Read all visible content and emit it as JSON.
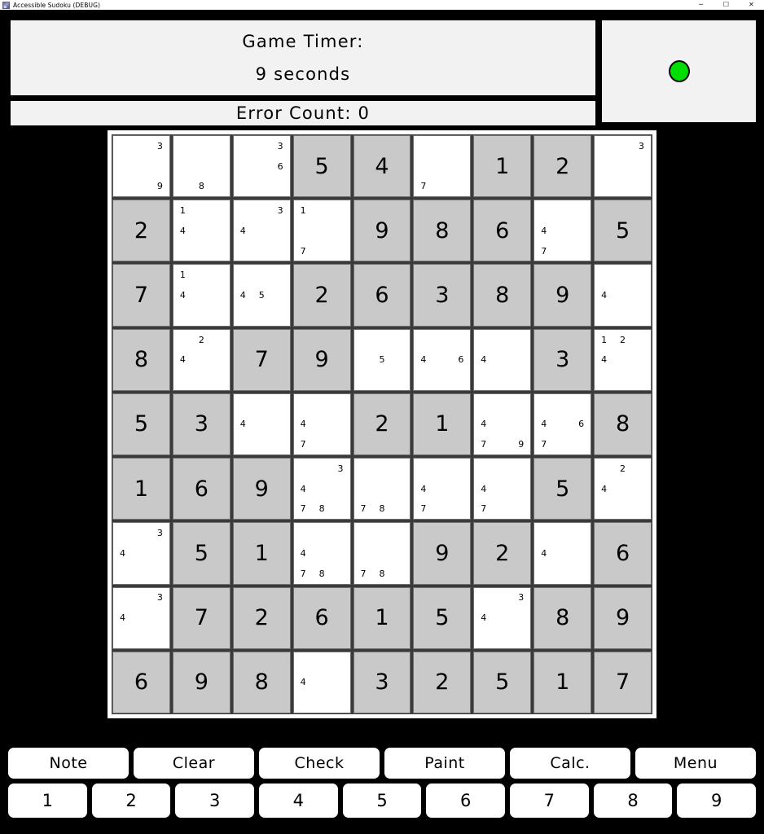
{
  "window": {
    "title": "Accessible Sudoku (DEBUG)",
    "icon": "app-icon",
    "controls": {
      "minimize": "─",
      "maximize": "☐",
      "close": "✕"
    }
  },
  "status": {
    "timer_label": "Game  Timer:",
    "timer_value": "9  seconds",
    "error_text": "Error  Count: 0",
    "indicator_color": "#00dd00",
    "indicator_name": "status-led"
  },
  "board": {
    "rows": [
      [
        {
          "value": null,
          "given": false,
          "notes": [
            3,
            9
          ]
        },
        {
          "value": null,
          "given": false,
          "notes": [
            8
          ]
        },
        {
          "value": null,
          "given": false,
          "notes": [
            3,
            6
          ]
        },
        {
          "value": "5",
          "given": true,
          "notes": []
        },
        {
          "value": "4",
          "given": true,
          "notes": []
        },
        {
          "value": null,
          "given": false,
          "notes": [
            7
          ]
        },
        {
          "value": "1",
          "given": true,
          "notes": []
        },
        {
          "value": "2",
          "given": true,
          "notes": []
        },
        {
          "value": null,
          "given": false,
          "notes": [
            3
          ]
        }
      ],
      [
        {
          "value": "2",
          "given": true,
          "notes": []
        },
        {
          "value": null,
          "given": false,
          "notes": [
            1,
            4
          ]
        },
        {
          "value": null,
          "given": false,
          "notes": [
            3,
            4
          ]
        },
        {
          "value": null,
          "given": false,
          "notes": [
            1,
            7
          ]
        },
        {
          "value": "9",
          "given": true,
          "notes": []
        },
        {
          "value": "8",
          "given": true,
          "notes": []
        },
        {
          "value": "6",
          "given": true,
          "notes": []
        },
        {
          "value": null,
          "given": false,
          "notes": [
            4,
            7
          ]
        },
        {
          "value": "5",
          "given": true,
          "notes": []
        }
      ],
      [
        {
          "value": "7",
          "given": true,
          "notes": []
        },
        {
          "value": null,
          "given": false,
          "notes": [
            1,
            4
          ]
        },
        {
          "value": null,
          "given": false,
          "notes": [
            4,
            5
          ]
        },
        {
          "value": "2",
          "given": true,
          "notes": []
        },
        {
          "value": "6",
          "given": true,
          "notes": []
        },
        {
          "value": "3",
          "given": true,
          "notes": []
        },
        {
          "value": "8",
          "given": true,
          "notes": []
        },
        {
          "value": "9",
          "given": true,
          "notes": []
        },
        {
          "value": null,
          "given": false,
          "notes": [
            4
          ]
        }
      ],
      [
        {
          "value": "8",
          "given": true,
          "notes": []
        },
        {
          "value": null,
          "given": false,
          "notes": [
            2,
            4
          ]
        },
        {
          "value": "7",
          "given": true,
          "notes": []
        },
        {
          "value": "9",
          "given": true,
          "notes": []
        },
        {
          "value": null,
          "given": false,
          "notes": [
            5
          ]
        },
        {
          "value": null,
          "given": false,
          "notes": [
            4,
            6
          ]
        },
        {
          "value": null,
          "given": false,
          "notes": [
            4
          ]
        },
        {
          "value": "3",
          "given": true,
          "notes": []
        },
        {
          "value": null,
          "given": false,
          "notes": [
            1,
            2,
            4
          ]
        }
      ],
      [
        {
          "value": "5",
          "given": true,
          "notes": []
        },
        {
          "value": "3",
          "given": true,
          "notes": []
        },
        {
          "value": null,
          "given": false,
          "notes": [
            4
          ]
        },
        {
          "value": null,
          "given": false,
          "notes": [
            4,
            7
          ]
        },
        {
          "value": "2",
          "given": true,
          "notes": []
        },
        {
          "value": "1",
          "given": true,
          "notes": []
        },
        {
          "value": null,
          "given": false,
          "notes": [
            4,
            7,
            9
          ]
        },
        {
          "value": null,
          "given": false,
          "notes": [
            4,
            6,
            7
          ]
        },
        {
          "value": "8",
          "given": true,
          "notes": []
        }
      ],
      [
        {
          "value": "1",
          "given": true,
          "notes": []
        },
        {
          "value": "6",
          "given": true,
          "notes": []
        },
        {
          "value": "9",
          "given": true,
          "notes": []
        },
        {
          "value": null,
          "given": false,
          "notes": [
            3,
            4,
            7,
            8
          ]
        },
        {
          "value": null,
          "given": false,
          "notes": [
            7,
            8
          ]
        },
        {
          "value": null,
          "given": false,
          "notes": [
            4,
            7
          ]
        },
        {
          "value": null,
          "given": false,
          "notes": [
            4,
            7
          ]
        },
        {
          "value": "5",
          "given": true,
          "notes": []
        },
        {
          "value": null,
          "given": false,
          "notes": [
            2,
            4
          ]
        }
      ],
      [
        {
          "value": null,
          "given": false,
          "notes": [
            3,
            4
          ]
        },
        {
          "value": "5",
          "given": true,
          "notes": []
        },
        {
          "value": "1",
          "given": true,
          "notes": []
        },
        {
          "value": null,
          "given": false,
          "notes": [
            4,
            7,
            8
          ]
        },
        {
          "value": null,
          "given": false,
          "notes": [
            7,
            8
          ]
        },
        {
          "value": "9",
          "given": true,
          "notes": []
        },
        {
          "value": "2",
          "given": true,
          "notes": []
        },
        {
          "value": null,
          "given": false,
          "notes": [
            4
          ]
        },
        {
          "value": "6",
          "given": true,
          "notes": []
        }
      ],
      [
        {
          "value": null,
          "given": false,
          "notes": [
            3,
            4
          ]
        },
        {
          "value": "7",
          "given": true,
          "notes": []
        },
        {
          "value": "2",
          "given": true,
          "notes": []
        },
        {
          "value": "6",
          "given": true,
          "notes": []
        },
        {
          "value": "1",
          "given": true,
          "notes": []
        },
        {
          "value": "5",
          "given": true,
          "notes": []
        },
        {
          "value": null,
          "given": false,
          "notes": [
            3,
            4
          ]
        },
        {
          "value": "8",
          "given": true,
          "notes": []
        },
        {
          "value": "9",
          "given": true,
          "notes": []
        }
      ],
      [
        {
          "value": "6",
          "given": true,
          "notes": []
        },
        {
          "value": "9",
          "given": true,
          "notes": []
        },
        {
          "value": "8",
          "given": true,
          "notes": []
        },
        {
          "value": null,
          "given": false,
          "notes": [
            4
          ]
        },
        {
          "value": "3",
          "given": true,
          "notes": []
        },
        {
          "value": "2",
          "given": true,
          "notes": []
        },
        {
          "value": "5",
          "given": true,
          "notes": []
        },
        {
          "value": "1",
          "given": true,
          "notes": []
        },
        {
          "value": "7",
          "given": true,
          "notes": []
        }
      ]
    ]
  },
  "actions": [
    "Note",
    "Clear",
    "Check",
    "Paint",
    "Calc.",
    "Menu"
  ],
  "numbers": [
    "1",
    "2",
    "3",
    "4",
    "5",
    "6",
    "7",
    "8",
    "9"
  ],
  "colors": {
    "given_cell": "#c9c9c9",
    "empty_cell": "#ffffff",
    "grid_line": "#3a3a3a",
    "background": "#000000",
    "panel": "#f2f2f2",
    "led_green": "#00dd00"
  }
}
